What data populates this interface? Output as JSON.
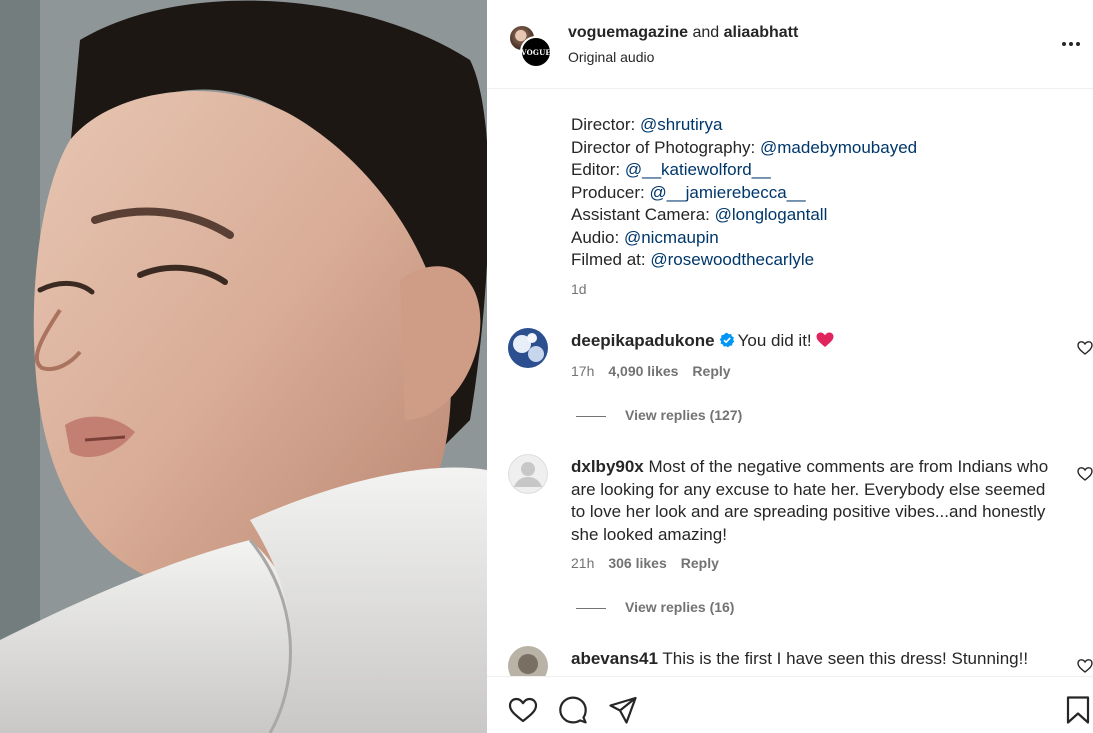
{
  "header": {
    "user_one": "voguemagazine",
    "conjunction": "and",
    "user_two": "aliaabhatt",
    "audio": "Original audio",
    "avatar_logo": "VOGUE"
  },
  "caption": {
    "credits": [
      {
        "label": "Director:",
        "mention": "@shrutirya"
      },
      {
        "label": "Director of Photography:",
        "mention": "@madebymoubayed"
      },
      {
        "label": "Editor:",
        "mention": "@__katiewolford__"
      },
      {
        "label": "Producer:",
        "mention": "@__jamierebecca__"
      },
      {
        "label": "Assistant Camera:",
        "mention": "@longlogantall"
      },
      {
        "label": "Audio:",
        "mention": "@nicmaupin"
      },
      {
        "label": "Filmed at:",
        "mention": "@rosewoodthecarlyle"
      }
    ],
    "time": "1d"
  },
  "comments": [
    {
      "user": "deepikapadukone",
      "verified": true,
      "text": "You did it!",
      "emoji": "red-heart",
      "time": "17h",
      "likes": "4,090 likes",
      "reply": "Reply",
      "view_replies": "View replies (127)"
    },
    {
      "user": "dxlby90x",
      "verified": false,
      "text": "Most of the negative comments are from Indians who are looking for any excuse to hate her. Everybody else seemed to love her look and are spreading positive vibes...and honestly she looked amazing!",
      "time": "21h",
      "likes": "306 likes",
      "reply": "Reply",
      "view_replies": "View replies (16)"
    },
    {
      "user": "abevans41",
      "verified": false,
      "text": "This is the first I have seen this dress! Stunning!!"
    }
  ],
  "icons": {
    "like": "heart-icon",
    "comment": "comment-icon",
    "share": "share-icon",
    "save": "bookmark-icon",
    "more": "more-icon"
  },
  "colors": {
    "mention": "#00376b",
    "verified": "#0095f6",
    "muted": "#737373",
    "emoji_heart": "#e0245e"
  }
}
